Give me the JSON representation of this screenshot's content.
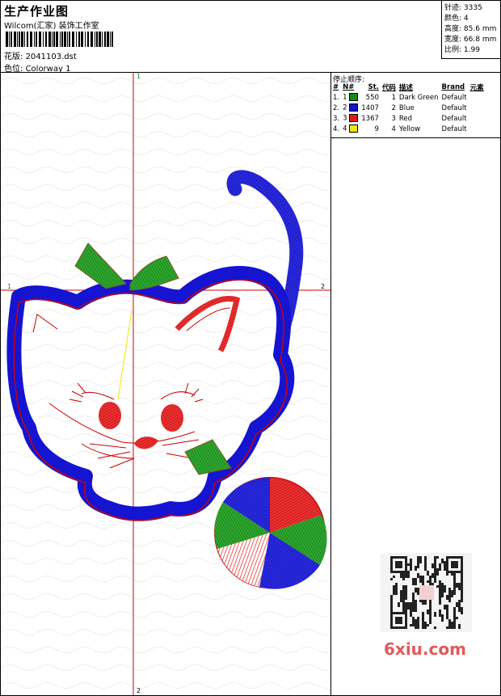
{
  "header": {
    "title": "生产作业图",
    "company": "Wilcom(汇家) 装饰工作室",
    "design_file_label": "花版:",
    "design_file": "2041103.dst",
    "colorway_label": "色位:",
    "colorway": "Colorway 1"
  },
  "stats": {
    "stitches_label": "针迹:",
    "stitches": "3335",
    "colors_label": "颜色:",
    "colors": "4",
    "height_label": "高度:",
    "height": "85.6 mm",
    "width_label": "宽度:",
    "width": "66.8 mm",
    "ratio_label": "比例:",
    "ratio": "1.99"
  },
  "stop_sequence": {
    "title": "停止顺序:",
    "headers": [
      "#",
      "N#",
      "St.",
      "代码",
      "描述",
      "Brand",
      "元素"
    ],
    "rows": [
      {
        "index": "1.",
        "n": "1",
        "color": "#118c11",
        "st": "550",
        "code": "1",
        "desc": "Dark Green",
        "brand": "Default"
      },
      {
        "index": "2.",
        "n": "2",
        "color": "#1414d2",
        "st": "1407",
        "code": "2",
        "desc": "Blue",
        "brand": "Default"
      },
      {
        "index": "3.",
        "n": "3",
        "color": "#e41a1a",
        "st": "1367",
        "code": "3",
        "desc": "Red",
        "brand": "Default"
      },
      {
        "index": "4.",
        "n": "4",
        "color": "#f0e60a",
        "st": "9",
        "code": "4",
        "desc": "Yellow",
        "brand": "Default"
      }
    ]
  },
  "axes": {
    "v_top": "1",
    "v_bottom": "2",
    "h_left": "1",
    "h_right": "2"
  },
  "watermark": "6xiu.com",
  "colors": {
    "guide": "#cc0000",
    "green": "#118c11",
    "blue": "#1414d2",
    "red": "#e41a1a",
    "yellow": "#f0e60a"
  }
}
